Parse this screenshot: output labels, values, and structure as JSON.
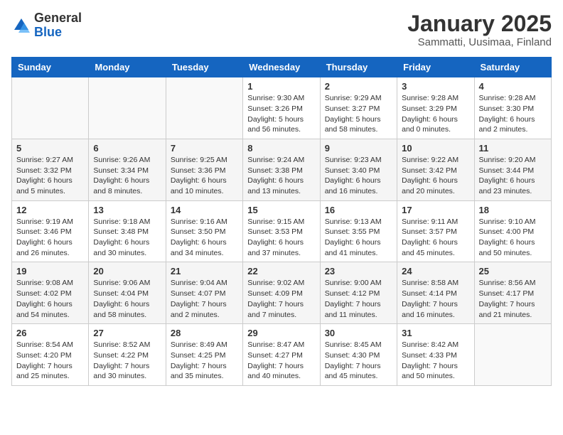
{
  "header": {
    "logo": {
      "general": "General",
      "blue": "Blue"
    },
    "title": "January 2025",
    "subtitle": "Sammatti, Uusimaa, Finland"
  },
  "days_of_week": [
    "Sunday",
    "Monday",
    "Tuesday",
    "Wednesday",
    "Thursday",
    "Friday",
    "Saturday"
  ],
  "weeks": [
    [
      {
        "day": "",
        "info": ""
      },
      {
        "day": "",
        "info": ""
      },
      {
        "day": "",
        "info": ""
      },
      {
        "day": "1",
        "info": "Sunrise: 9:30 AM\nSunset: 3:26 PM\nDaylight: 5 hours\nand 56 minutes."
      },
      {
        "day": "2",
        "info": "Sunrise: 9:29 AM\nSunset: 3:27 PM\nDaylight: 5 hours\nand 58 minutes."
      },
      {
        "day": "3",
        "info": "Sunrise: 9:28 AM\nSunset: 3:29 PM\nDaylight: 6 hours\nand 0 minutes."
      },
      {
        "day": "4",
        "info": "Sunrise: 9:28 AM\nSunset: 3:30 PM\nDaylight: 6 hours\nand 2 minutes."
      }
    ],
    [
      {
        "day": "5",
        "info": "Sunrise: 9:27 AM\nSunset: 3:32 PM\nDaylight: 6 hours\nand 5 minutes."
      },
      {
        "day": "6",
        "info": "Sunrise: 9:26 AM\nSunset: 3:34 PM\nDaylight: 6 hours\nand 8 minutes."
      },
      {
        "day": "7",
        "info": "Sunrise: 9:25 AM\nSunset: 3:36 PM\nDaylight: 6 hours\nand 10 minutes."
      },
      {
        "day": "8",
        "info": "Sunrise: 9:24 AM\nSunset: 3:38 PM\nDaylight: 6 hours\nand 13 minutes."
      },
      {
        "day": "9",
        "info": "Sunrise: 9:23 AM\nSunset: 3:40 PM\nDaylight: 6 hours\nand 16 minutes."
      },
      {
        "day": "10",
        "info": "Sunrise: 9:22 AM\nSunset: 3:42 PM\nDaylight: 6 hours\nand 20 minutes."
      },
      {
        "day": "11",
        "info": "Sunrise: 9:20 AM\nSunset: 3:44 PM\nDaylight: 6 hours\nand 23 minutes."
      }
    ],
    [
      {
        "day": "12",
        "info": "Sunrise: 9:19 AM\nSunset: 3:46 PM\nDaylight: 6 hours\nand 26 minutes."
      },
      {
        "day": "13",
        "info": "Sunrise: 9:18 AM\nSunset: 3:48 PM\nDaylight: 6 hours\nand 30 minutes."
      },
      {
        "day": "14",
        "info": "Sunrise: 9:16 AM\nSunset: 3:50 PM\nDaylight: 6 hours\nand 34 minutes."
      },
      {
        "day": "15",
        "info": "Sunrise: 9:15 AM\nSunset: 3:53 PM\nDaylight: 6 hours\nand 37 minutes."
      },
      {
        "day": "16",
        "info": "Sunrise: 9:13 AM\nSunset: 3:55 PM\nDaylight: 6 hours\nand 41 minutes."
      },
      {
        "day": "17",
        "info": "Sunrise: 9:11 AM\nSunset: 3:57 PM\nDaylight: 6 hours\nand 45 minutes."
      },
      {
        "day": "18",
        "info": "Sunrise: 9:10 AM\nSunset: 4:00 PM\nDaylight: 6 hours\nand 50 minutes."
      }
    ],
    [
      {
        "day": "19",
        "info": "Sunrise: 9:08 AM\nSunset: 4:02 PM\nDaylight: 6 hours\nand 54 minutes."
      },
      {
        "day": "20",
        "info": "Sunrise: 9:06 AM\nSunset: 4:04 PM\nDaylight: 6 hours\nand 58 minutes."
      },
      {
        "day": "21",
        "info": "Sunrise: 9:04 AM\nSunset: 4:07 PM\nDaylight: 7 hours\nand 2 minutes."
      },
      {
        "day": "22",
        "info": "Sunrise: 9:02 AM\nSunset: 4:09 PM\nDaylight: 7 hours\nand 7 minutes."
      },
      {
        "day": "23",
        "info": "Sunrise: 9:00 AM\nSunset: 4:12 PM\nDaylight: 7 hours\nand 11 minutes."
      },
      {
        "day": "24",
        "info": "Sunrise: 8:58 AM\nSunset: 4:14 PM\nDaylight: 7 hours\nand 16 minutes."
      },
      {
        "day": "25",
        "info": "Sunrise: 8:56 AM\nSunset: 4:17 PM\nDaylight: 7 hours\nand 21 minutes."
      }
    ],
    [
      {
        "day": "26",
        "info": "Sunrise: 8:54 AM\nSunset: 4:20 PM\nDaylight: 7 hours\nand 25 minutes."
      },
      {
        "day": "27",
        "info": "Sunrise: 8:52 AM\nSunset: 4:22 PM\nDaylight: 7 hours\nand 30 minutes."
      },
      {
        "day": "28",
        "info": "Sunrise: 8:49 AM\nSunset: 4:25 PM\nDaylight: 7 hours\nand 35 minutes."
      },
      {
        "day": "29",
        "info": "Sunrise: 8:47 AM\nSunset: 4:27 PM\nDaylight: 7 hours\nand 40 minutes."
      },
      {
        "day": "30",
        "info": "Sunrise: 8:45 AM\nSunset: 4:30 PM\nDaylight: 7 hours\nand 45 minutes."
      },
      {
        "day": "31",
        "info": "Sunrise: 8:42 AM\nSunset: 4:33 PM\nDaylight: 7 hours\nand 50 minutes."
      },
      {
        "day": "",
        "info": ""
      }
    ]
  ]
}
